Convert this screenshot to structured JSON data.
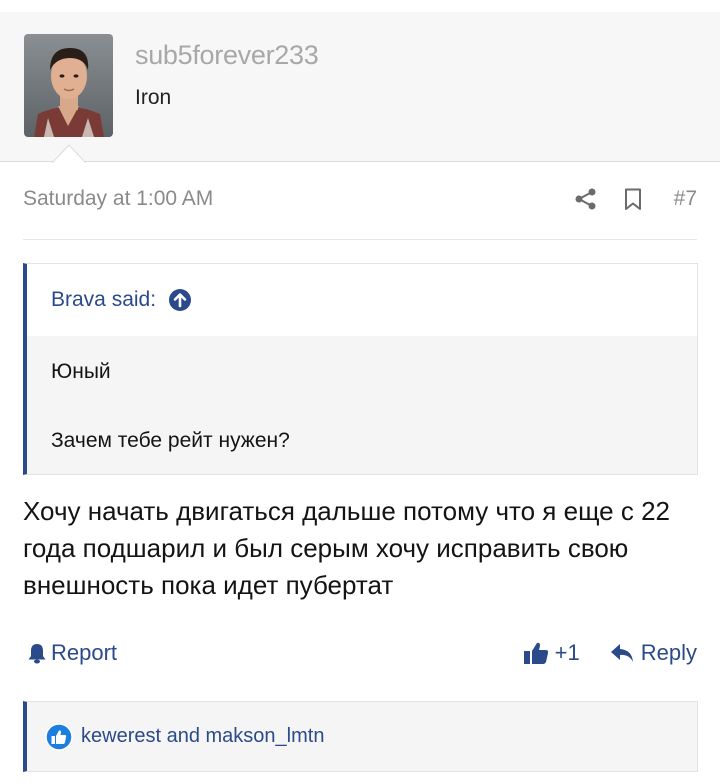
{
  "author": {
    "username": "sub5forever233",
    "rank": "Iron"
  },
  "meta": {
    "date": "Saturday at 1:00 AM",
    "post_number": "#7"
  },
  "quote": {
    "author_label": "Brava said:",
    "lines": [
      "Юный",
      "Зачем тебе рейт нужен?"
    ]
  },
  "body": {
    "text": "Хочу начать двигаться дальше потому что я еще с 22 года подшарил и был серым хочу исправить свою внешность пока идет пубертат"
  },
  "actions": {
    "report_label": "Report",
    "like_count": "+1",
    "reply_label": "Reply"
  },
  "reactions": {
    "names": "kewerest and makson_lmtn"
  },
  "colors": {
    "link": "#2b4a8a",
    "muted": "#8a8a8a",
    "reaction_blue": "#1c7fe0"
  },
  "icons": [
    "share-icon",
    "bookmark-icon",
    "arrow-up-circle-icon",
    "bell-icon",
    "thumbs-up-icon",
    "reply-icon",
    "like-reaction-icon"
  ]
}
